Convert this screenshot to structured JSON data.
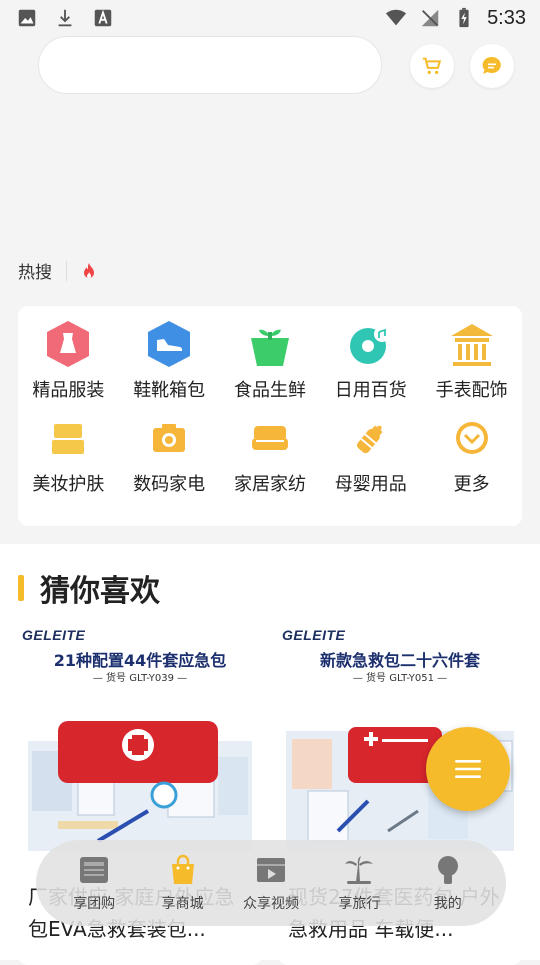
{
  "status_bar": {
    "time": "5:33",
    "left_icons": [
      "image-icon",
      "download-icon",
      "font-icon"
    ],
    "right_icons": [
      "wifi-icon",
      "no-signal-icon",
      "battery-charging-icon"
    ]
  },
  "header": {
    "search_placeholder": "",
    "cart_icon": "cart-icon",
    "message_icon": "message-icon"
  },
  "hot_search": {
    "label": "热搜",
    "icon": "fire-icon"
  },
  "categories": [
    {
      "label": "精品服装",
      "icon": "dress-icon",
      "color": "#f06a78"
    },
    {
      "label": "鞋靴箱包",
      "icon": "shoe-icon",
      "color": "#3f8fe4"
    },
    {
      "label": "食品生鲜",
      "icon": "plant-icon",
      "color": "#3ccd6a"
    },
    {
      "label": "日用百货",
      "icon": "disc-icon",
      "color": "#2fc6b4"
    },
    {
      "label": "手表配饰",
      "icon": "temple-icon",
      "color": "#f2b93a"
    },
    {
      "label": "美妆护肤",
      "icon": "cosmetics-icon",
      "color": "#f6c84a"
    },
    {
      "label": "数码家电",
      "icon": "camera-icon",
      "color": "#f6b63a"
    },
    {
      "label": "家居家纺",
      "icon": "sofa-icon",
      "color": "#f6b63a"
    },
    {
      "label": "母婴用品",
      "icon": "bottle-icon",
      "color": "#f6b63a"
    },
    {
      "label": "更多",
      "icon": "more-icon",
      "color": "#f6b63a"
    }
  ],
  "section": {
    "title": "猜你喜欢",
    "accent": "#f6bb2a"
  },
  "products": [
    {
      "brand": "GELEITE",
      "image_title": "21种配置44件套应急包",
      "image_sub": "— 货号 GLT-Y039 —",
      "name": "厂家供应 家庭户外应急包EVA急救套装包..."
    },
    {
      "brand": "GELEITE",
      "image_title": "新款急救包二十六件套",
      "image_sub": "— 货号 GLT-Y051 —",
      "name": "现货27件套医药包 户外急救用品 车载便..."
    }
  ],
  "fab": {
    "icon": "menu-icon",
    "color": "#f6bb2a"
  },
  "bottom_nav": [
    {
      "label": "享团购",
      "icon": "news-icon"
    },
    {
      "label": "享商城",
      "icon": "shopping-bag-icon",
      "active_color": "#f6bb2a"
    },
    {
      "label": "众享视频",
      "icon": "video-icon"
    },
    {
      "label": "享旅行",
      "icon": "palm-tree-icon"
    },
    {
      "label": "我的",
      "icon": "profile-icon"
    }
  ]
}
